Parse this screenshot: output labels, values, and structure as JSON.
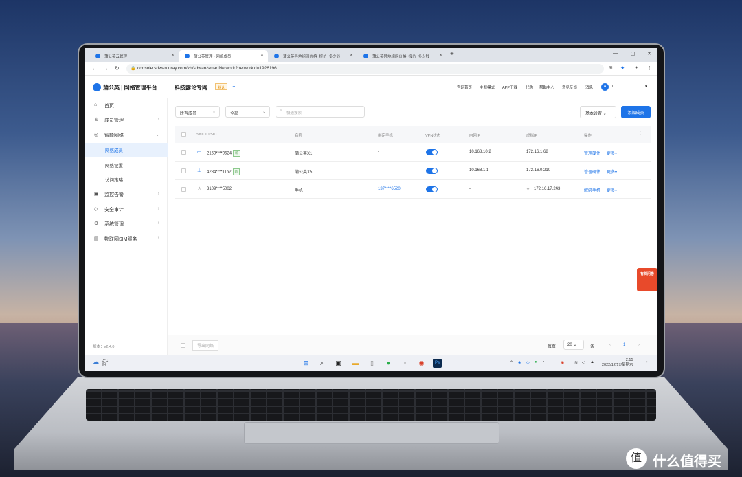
{
  "browser": {
    "tabs": [
      {
        "label": "蒲公英云管理"
      },
      {
        "label": "蒲公英管理 · 网络成员"
      },
      {
        "label": "蒲公英异地组网价格_报价_多少钱"
      },
      {
        "label": "蒲公英异地组网价格_报价_多少钱"
      }
    ],
    "new_tab": "+",
    "url": "console.sdwan.oray.com/zh/sdwan/smartNetwork?networkid=1926196"
  },
  "header": {
    "brand": "蒲公英 | 网络管理平台",
    "network_name": "科技露论专网",
    "default_tag": "默认",
    "links": [
      "官网首页",
      "主题模式",
      "APP下载",
      "代购",
      "帮助中心",
      "意见反馈",
      "消息"
    ],
    "username": "1"
  },
  "sidebar": {
    "items": [
      {
        "label": "首页",
        "icon": "home-icon"
      },
      {
        "label": "成员管理",
        "icon": "user-icon"
      },
      {
        "label": "智能网络",
        "icon": "network-icon"
      },
      {
        "label": "网络成员",
        "icon": ""
      },
      {
        "label": "网络设置",
        "icon": ""
      },
      {
        "label": "访问策略",
        "icon": ""
      },
      {
        "label": "监控告警",
        "icon": "monitor-icon"
      },
      {
        "label": "安全审计",
        "icon": "shield-icon"
      },
      {
        "label": "系统管理",
        "icon": "settings-icon"
      },
      {
        "label": "物联网SIM服务",
        "icon": "sim-icon"
      }
    ],
    "version": "版本：v2.4.0"
  },
  "toolbar": {
    "filter_member": "所有成员",
    "filter_all": "全部",
    "search_placeholder": "快速搜索",
    "basic_settings": "基本设置",
    "add_member": "添加成员"
  },
  "table": {
    "headers": [
      "SN/UID/SID",
      "名称",
      "绑定手机",
      "VPN状态",
      "内网IP",
      "虚拟IP",
      "操作"
    ],
    "rows": [
      {
        "id": "2169****9624",
        "tag": "新",
        "name": "蒲公英X1",
        "phone": "-",
        "lan_ip": "10.168.10.2",
        "virtual_ip": "172.16.1.68",
        "action": "管理硬件",
        "more": "更多"
      },
      {
        "id": "4284****1152",
        "tag": "新",
        "name": "蒲公英X5",
        "phone": "-",
        "lan_ip": "10.168.1.1",
        "virtual_ip": "172.16.0.210",
        "action": "管理硬件",
        "more": "更多"
      },
      {
        "id": "3109****5002",
        "tag": "",
        "name": "手机",
        "phone": "137****6520",
        "lan_ip": "-",
        "virtual_ip": "172.16.17.243",
        "action": "解绑手机",
        "more": "更多"
      }
    ]
  },
  "footer": {
    "export": "导出网络",
    "per_page_label": "每页",
    "per_page": "20",
    "total_label": "条",
    "current_page": "1"
  },
  "side_flag": "有奖问卷",
  "taskbar": {
    "weather_temp": "3°C",
    "weather_desc": "阴",
    "time": "2:15",
    "date": "2022/12/17/星期六"
  },
  "watermark": "什么值得买",
  "colors": {
    "accent": "#1e74e8",
    "sidebar_active_bg": "#e8f1fd",
    "tag_new": "#52a152",
    "tag_default": "#e38b00"
  }
}
